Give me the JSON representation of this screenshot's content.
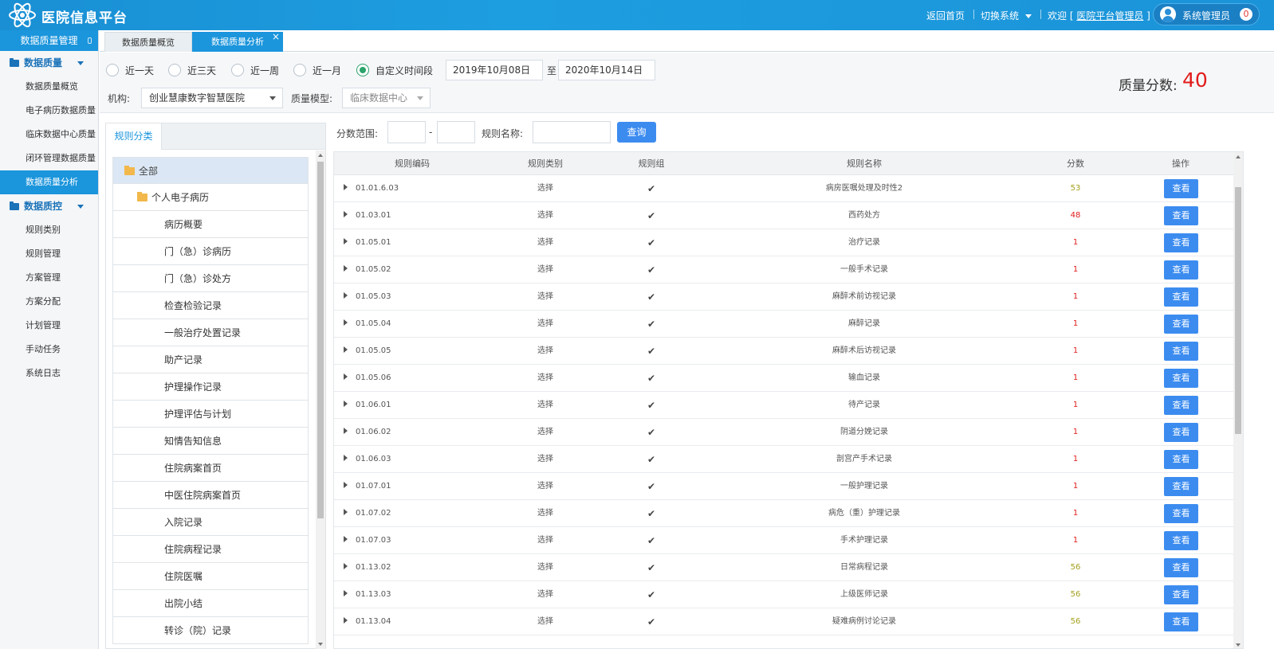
{
  "header": {
    "app_title": "医院信息平台",
    "home_link": "返回首页",
    "switch_system": "切换系统",
    "welcome_prefix": "欢迎 [",
    "welcome_user": "医院平台管理员",
    "welcome_suffix": "]",
    "user_name": "系统管理员",
    "notification_count": "0"
  },
  "sidebar": {
    "title": "数据质量管理",
    "groups": [
      {
        "label": "数据质量",
        "items": [
          "数据质量概览",
          "电子病历数据质量",
          "临床数据中心质量",
          "闭环管理数据质量",
          "数据质量分析"
        ]
      },
      {
        "label": "数据质控",
        "items": [
          "规则类别",
          "规则管理",
          "方案管理",
          "方案分配",
          "计划管理",
          "手动任务",
          "系统日志"
        ]
      }
    ],
    "active_item": "数据质量分析"
  },
  "tabs": [
    {
      "label": "数据质量概览",
      "active": false
    },
    {
      "label": "数据质量分析",
      "active": true
    }
  ],
  "tab_close": "×",
  "filters": {
    "time_options": [
      "近一天",
      "近三天",
      "近一周",
      "近一月",
      "自定义时间段"
    ],
    "selected_time": "自定义时间段",
    "date_from": "2019年10月08日",
    "date_sep": "至",
    "date_to": "2020年10月14日",
    "org_label": "机构:",
    "org_value": "创业慧康数字智慧医院",
    "model_label": "质量模型:",
    "model_value": "临床数据中心",
    "score_label": "质量分数:",
    "score_value": "40"
  },
  "tree": {
    "tab_label": "规则分类",
    "nodes": [
      {
        "label": "全部",
        "level": 1,
        "folder": true
      },
      {
        "label": "个人电子病历",
        "level": 2,
        "folder": true
      },
      {
        "label": "病历概要",
        "level": 3
      },
      {
        "label": "门（急）诊病历",
        "level": 3
      },
      {
        "label": "门（急）诊处方",
        "level": 3
      },
      {
        "label": "检查检验记录",
        "level": 3
      },
      {
        "label": "一般治疗处置记录",
        "level": 3
      },
      {
        "label": "助产记录",
        "level": 3
      },
      {
        "label": "护理操作记录",
        "level": 3
      },
      {
        "label": "护理评估与计划",
        "level": 3
      },
      {
        "label": "知情告知信息",
        "level": 3
      },
      {
        "label": "住院病案首页",
        "level": 3
      },
      {
        "label": "中医住院病案首页",
        "level": 3
      },
      {
        "label": "入院记录",
        "level": 3
      },
      {
        "label": "住院病程记录",
        "level": 3
      },
      {
        "label": "住院医嘱",
        "level": 3
      },
      {
        "label": "出院小结",
        "level": 3
      },
      {
        "label": "转诊（院）记录",
        "level": 3
      }
    ]
  },
  "rule_filter": {
    "score_range_label": "分数范围:",
    "range_sep": "-",
    "rule_name_label": "规则名称:",
    "query_button": "查询"
  },
  "table": {
    "columns": [
      "规则编码",
      "规则类别",
      "规则组",
      "规则名称",
      "分数",
      "操作"
    ],
    "view_button": "查看",
    "check_mark": "✔",
    "rows": [
      {
        "code": "01.01.6.03",
        "category": "选择",
        "name": "病房医嘱处理及时性2",
        "score": "53",
        "score_color": "olive"
      },
      {
        "code": "01.03.01",
        "category": "选择",
        "name": "西药处方",
        "score": "48",
        "score_color": "red"
      },
      {
        "code": "01.05.01",
        "category": "选择",
        "name": "治疗记录",
        "score": "1",
        "score_color": "red"
      },
      {
        "code": "01.05.02",
        "category": "选择",
        "name": "一般手术记录",
        "score": "1",
        "score_color": "red"
      },
      {
        "code": "01.05.03",
        "category": "选择",
        "name": "麻醉术前访视记录",
        "score": "1",
        "score_color": "red"
      },
      {
        "code": "01.05.04",
        "category": "选择",
        "name": "麻醉记录",
        "score": "1",
        "score_color": "red"
      },
      {
        "code": "01.05.05",
        "category": "选择",
        "name": "麻醉术后访视记录",
        "score": "1",
        "score_color": "red"
      },
      {
        "code": "01.05.06",
        "category": "选择",
        "name": "输血记录",
        "score": "1",
        "score_color": "red"
      },
      {
        "code": "01.06.01",
        "category": "选择",
        "name": "待产记录",
        "score": "1",
        "score_color": "red"
      },
      {
        "code": "01.06.02",
        "category": "选择",
        "name": "阴道分娩记录",
        "score": "1",
        "score_color": "red"
      },
      {
        "code": "01.06.03",
        "category": "选择",
        "name": "剖宫产手术记录",
        "score": "1",
        "score_color": "red"
      },
      {
        "code": "01.07.01",
        "category": "选择",
        "name": "一般护理记录",
        "score": "1",
        "score_color": "red"
      },
      {
        "code": "01.07.02",
        "category": "选择",
        "name": "病危（重）护理记录",
        "score": "1",
        "score_color": "red"
      },
      {
        "code": "01.07.03",
        "category": "选择",
        "name": "手术护理记录",
        "score": "1",
        "score_color": "red"
      },
      {
        "code": "01.13.02",
        "category": "选择",
        "name": "日常病程记录",
        "score": "56",
        "score_color": "olive"
      },
      {
        "code": "01.13.03",
        "category": "选择",
        "name": "上级医师记录",
        "score": "56",
        "score_color": "olive"
      },
      {
        "code": "01.13.04",
        "category": "选择",
        "name": "疑难病例讨论记录",
        "score": "56",
        "score_color": "olive"
      }
    ]
  },
  "colors": {
    "header_blue": "#1b93d8",
    "accent_blue": "#1b95dc",
    "button_blue": "#3c8cf0",
    "score_red": "#e21b1b",
    "score_olive": "#a5a020",
    "radio_green": "#2aa46b"
  }
}
